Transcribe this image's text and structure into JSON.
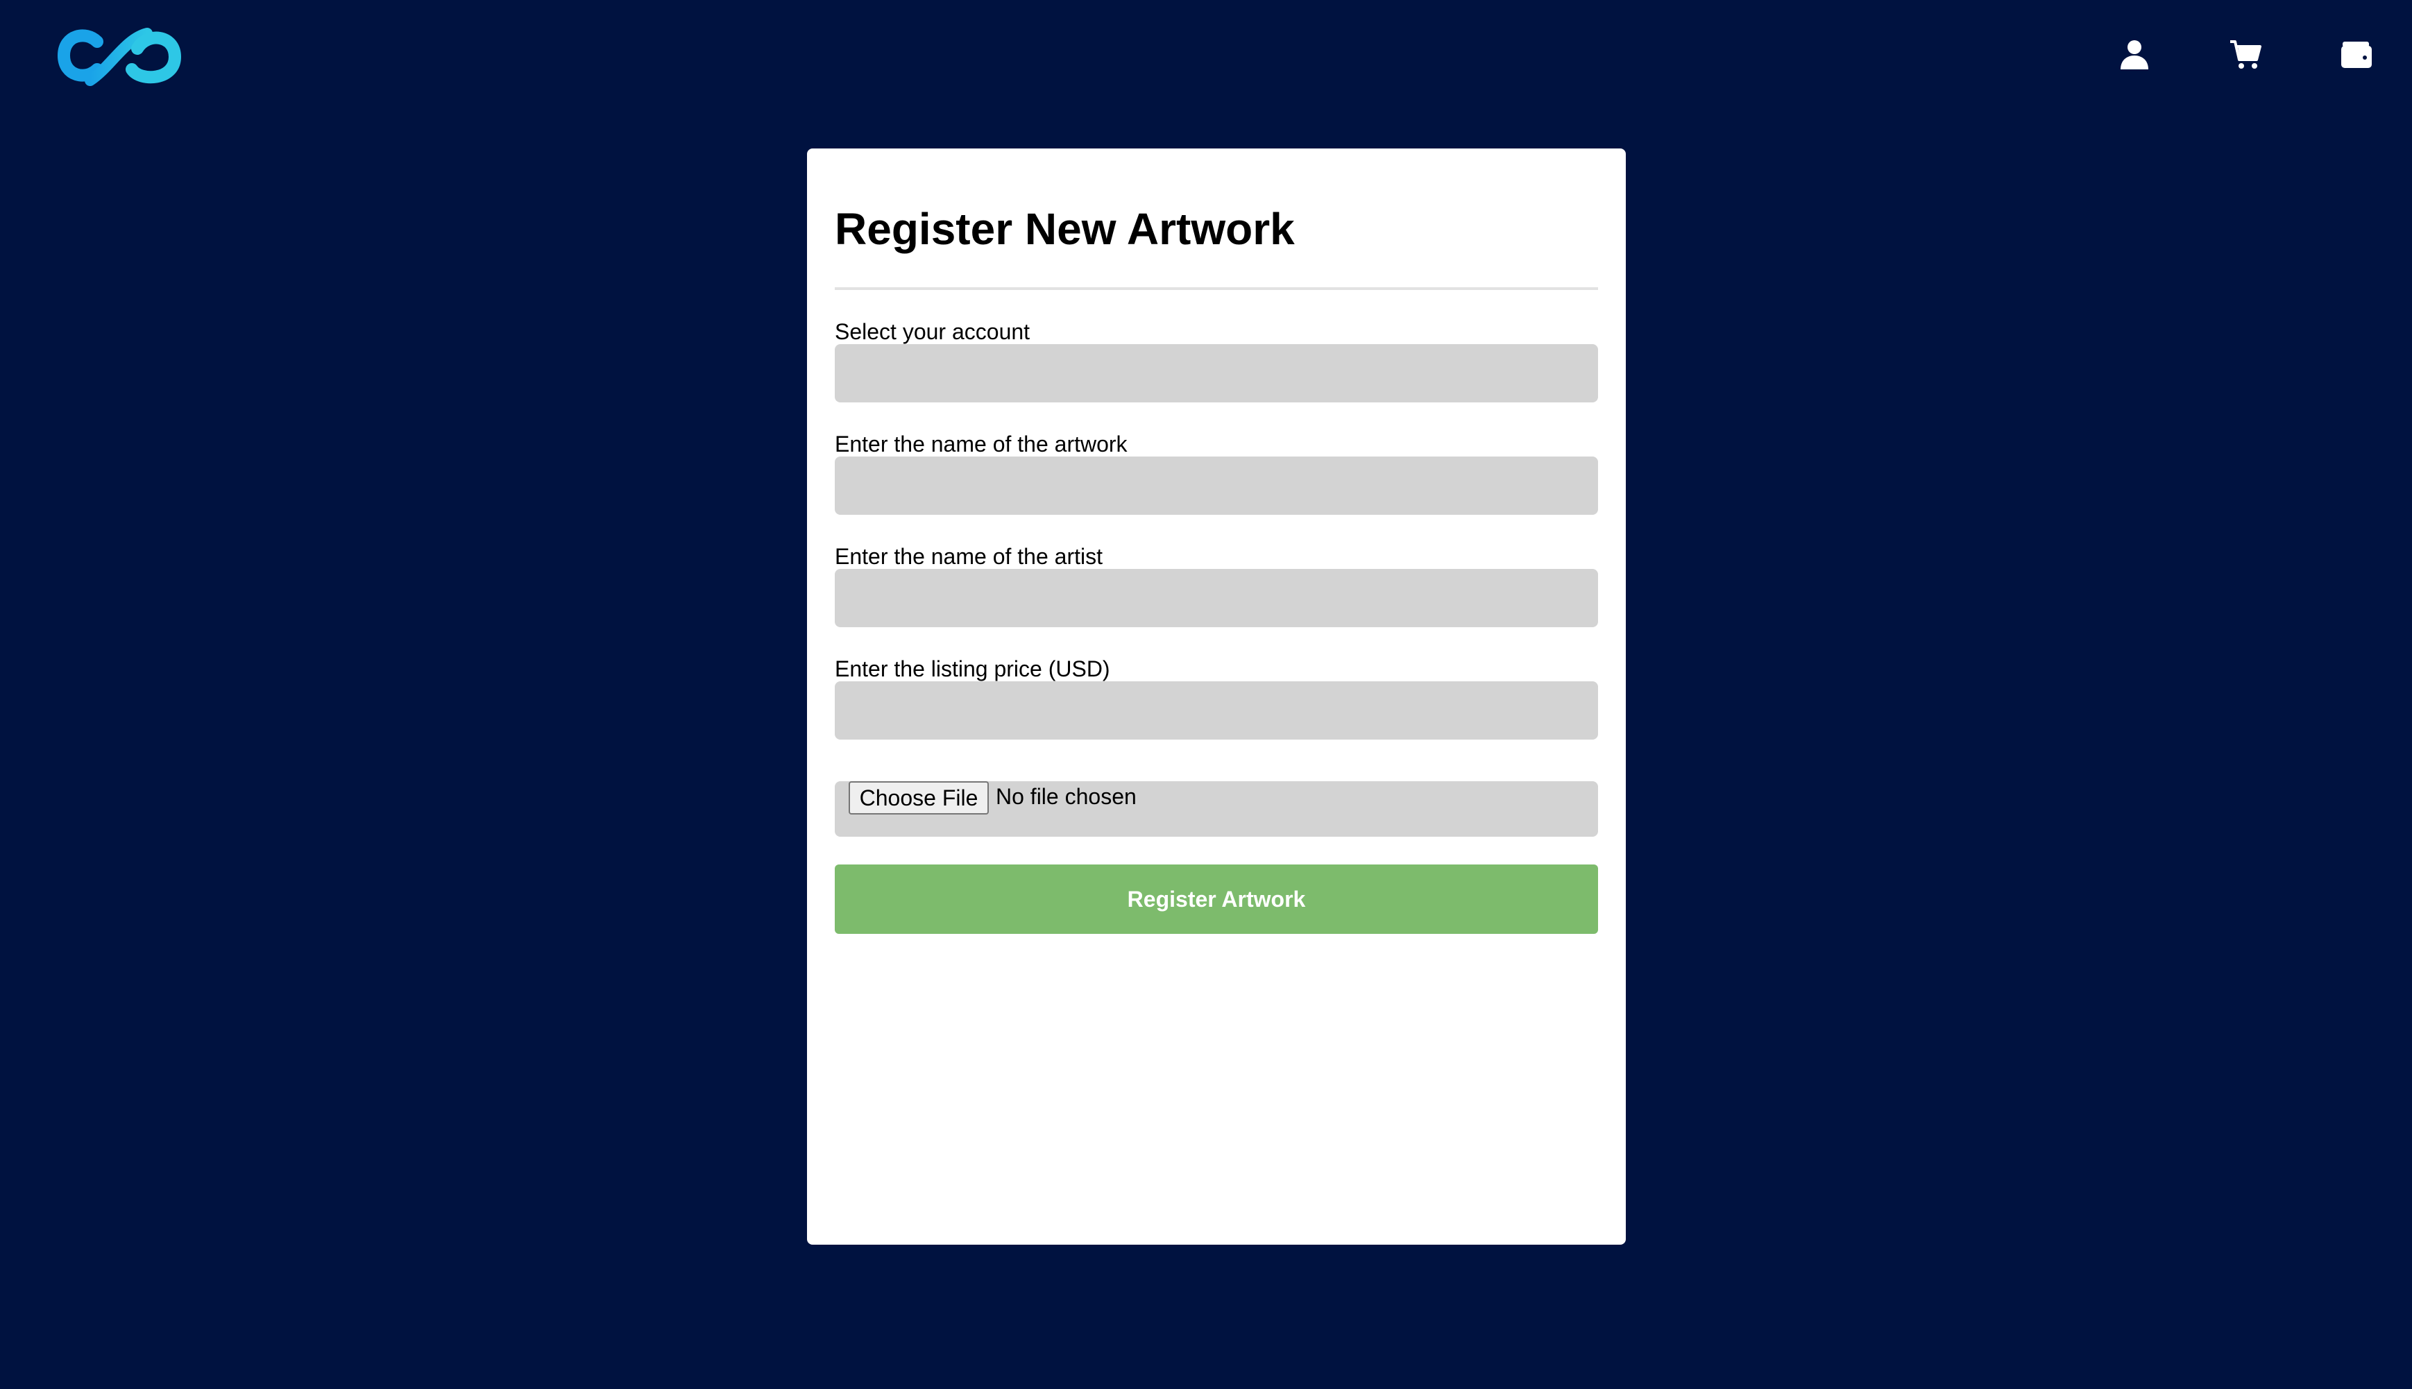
{
  "header": {
    "logo_icon": "infinity-logo-icon",
    "logo_colors": [
      "#1aa3e8",
      "#2ec7e6"
    ],
    "nav_icons": [
      "user-icon",
      "cart-icon",
      "wallet-icon"
    ]
  },
  "form": {
    "title": "Register New Artwork",
    "fields": [
      {
        "label": "Select your account",
        "value": ""
      },
      {
        "label": "Enter the name of the artwork",
        "value": ""
      },
      {
        "label": "Enter the name of the artist",
        "value": ""
      },
      {
        "label": "Enter the listing price (USD)",
        "value": ""
      }
    ],
    "file": {
      "button_label": "Choose File",
      "status": "No file chosen"
    },
    "submit_label": "Register Artwork"
  },
  "colors": {
    "background": "#001240",
    "card": "#ffffff",
    "field": "#d3d3d3",
    "submit": "#7dbb6c"
  }
}
